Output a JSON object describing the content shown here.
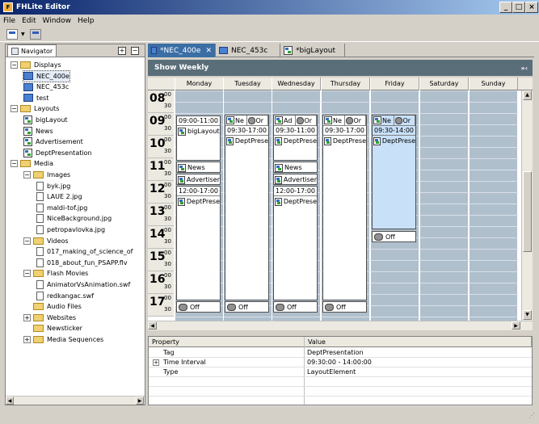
{
  "window": {
    "title": "FHLite Editor",
    "minimize": "_",
    "maximize": "□",
    "close": "×"
  },
  "menu": {
    "items": [
      "File",
      "Edit",
      "Window",
      "Help"
    ]
  },
  "navigator": {
    "tab_label": "Navigator",
    "plus": "+",
    "minus": "−",
    "tree": [
      {
        "label": "Displays",
        "type": "folder",
        "expand": "−",
        "level": 0
      },
      {
        "label": "NEC_400e",
        "type": "display",
        "level": 1,
        "selected": true
      },
      {
        "label": "NEC_453c",
        "type": "display",
        "level": 1
      },
      {
        "label": "test",
        "type": "display",
        "level": 1
      },
      {
        "label": "Layouts",
        "type": "folder",
        "expand": "−",
        "level": 0
      },
      {
        "label": "bigLayout",
        "type": "layout",
        "level": 1
      },
      {
        "label": "News",
        "type": "layout",
        "level": 1
      },
      {
        "label": "Advertisement",
        "type": "layout",
        "level": 1
      },
      {
        "label": "DeptPresentation",
        "type": "layout",
        "level": 1
      },
      {
        "label": "Media",
        "type": "folder",
        "expand": "−",
        "level": 0
      },
      {
        "label": "Images",
        "type": "folder",
        "expand": "−",
        "level": 1
      },
      {
        "label": "byk.jpg",
        "type": "file",
        "level": 2
      },
      {
        "label": "LAUE 2.jpg",
        "type": "file",
        "level": 2
      },
      {
        "label": "maldi-tof.jpg",
        "type": "file",
        "level": 2
      },
      {
        "label": "NiceBackground.jpg",
        "type": "file",
        "level": 2
      },
      {
        "label": "petropavlovka.jpg",
        "type": "file",
        "level": 2
      },
      {
        "label": "Videos",
        "type": "folder",
        "expand": "−",
        "level": 1
      },
      {
        "label": "017_making_of_science_of",
        "type": "file",
        "level": 2
      },
      {
        "label": "018_about_fun_PSAPP.flv",
        "type": "file",
        "level": 2
      },
      {
        "label": "Flash Movies",
        "type": "folder",
        "expand": "−",
        "level": 1
      },
      {
        "label": "AnimatorVsAnimation.swf",
        "type": "file",
        "level": 2
      },
      {
        "label": "redkangac.swf",
        "type": "file",
        "level": 2
      },
      {
        "label": "Audio Files",
        "type": "folder",
        "expand": "",
        "level": 1
      },
      {
        "label": "Websites",
        "type": "folder",
        "expand": "+",
        "level": 1
      },
      {
        "label": "Newsticker",
        "type": "folder",
        "expand": "",
        "level": 1
      },
      {
        "label": "Media Sequences",
        "type": "folder",
        "expand": "+",
        "level": 1
      }
    ]
  },
  "editor_tabs": [
    {
      "label": "*NEC_400e",
      "active": true,
      "close": "✕"
    },
    {
      "label": "NEC_453c",
      "active": false
    },
    {
      "label": "*bigLayout",
      "active": false
    }
  ],
  "calendar": {
    "title": "Show Weekly",
    "collapse": "»‹",
    "days": [
      "Monday",
      "Tuesday",
      "Wednesday",
      "Thursday",
      "Friday",
      "Saturday",
      "Sunday"
    ],
    "hours": [
      "08",
      "09",
      "10",
      "11",
      "12",
      "13",
      "14",
      "15",
      "16",
      "17"
    ],
    "min_top": "00",
    "min_bottom": "30",
    "events": {
      "mon_1_time": "09:00-11:00",
      "mon_1_name": "bigLayout",
      "mon_2_name": "News",
      "mon_3_name": "Advertiser",
      "mon_4_time": "12:00-17:00",
      "mon_4_name": "DeptPrese",
      "tue_chip_a": "Ne",
      "tue_chip_b": "Or",
      "tue_time": "09:30-17:00",
      "tue_name": "DeptPrese",
      "wed_chip_a": "Ad",
      "wed_chip_b": "Or",
      "wed_1_time": "09:30-11:00",
      "wed_1_name": "DeptPrese",
      "wed_2_name": "News",
      "wed_3_name": "Advertiser",
      "wed_4_time": "12:00-17:00",
      "wed_4_name": "DeptPrese",
      "thu_chip_a": "Ne",
      "thu_chip_b": "Or",
      "thu_time": "09:30-17:00",
      "thu_name": "DeptPrese",
      "fri_chip_a": "Ne",
      "fri_chip_b": "Or",
      "fri_time": "09:30-14:00",
      "fri_name": "DeptPrese",
      "off": "Off"
    }
  },
  "properties": {
    "col_property": "Property",
    "col_value": "Value",
    "rows": [
      {
        "key": "Tag",
        "value": "DeptPresentation",
        "expand": ""
      },
      {
        "key": "Time Interval",
        "value": "09:30:00 - 14:00:00",
        "expand": "+"
      },
      {
        "key": "Type",
        "value": "LayoutElement",
        "expand": ""
      }
    ]
  }
}
